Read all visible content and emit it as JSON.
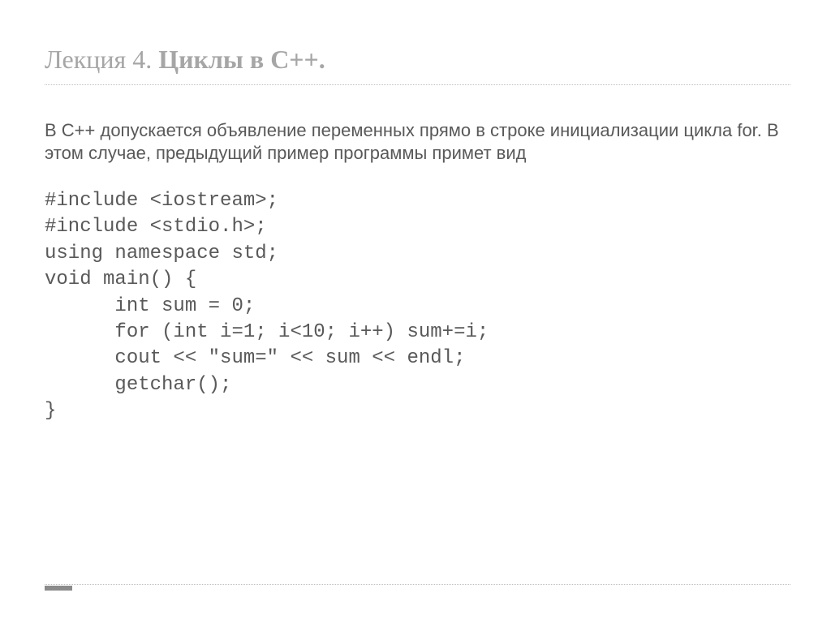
{
  "title": {
    "prefix": "Лекция 4. ",
    "bold": "Циклы в С++."
  },
  "paragraph": " В С++ допускается объявление переменных прямо в строке инициализации цикла for. В этом случае, предыдущий пример программы примет вид",
  "code": "#include <iostream>;\n#include <stdio.h>;\nusing namespace std;\nvoid main() {\n      int sum = 0;\n      for (int i=1; i<10; i++) sum+=i;\n      cout << \"sum=\" << sum << endl;\n      getchar();\n}"
}
